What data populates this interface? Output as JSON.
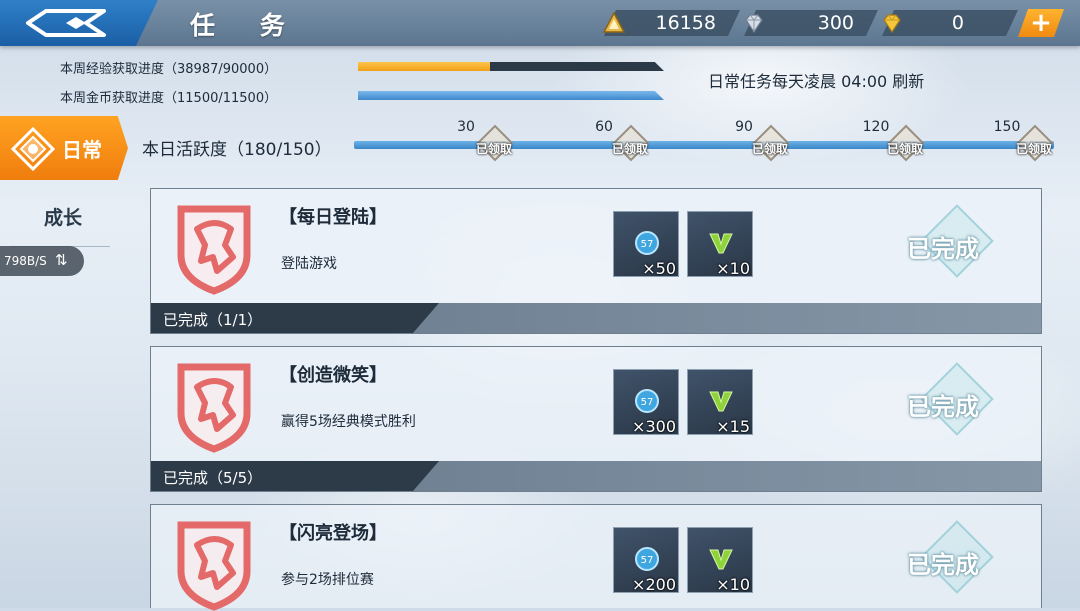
{
  "header": {
    "title": "任 务",
    "currencies": [
      {
        "icon": "gold-triangle-icon",
        "value": "16158"
      },
      {
        "icon": "diamond-icon",
        "value": "300"
      },
      {
        "icon": "gold-diamond-icon",
        "value": "0"
      }
    ],
    "plus_label": "+"
  },
  "weekly": {
    "exp_label": "本周经验获取进度（38987/90000）",
    "exp_progress": 0.433,
    "gold_label": "本周金币获取进度（11500/11500）",
    "gold_progress": 1.0,
    "reset_note": "日常任务每天凌晨 04:00 刷新"
  },
  "sidebar": {
    "tabs": [
      {
        "label": "日常",
        "active": true
      },
      {
        "label": "成长",
        "active": false
      }
    ],
    "net_speed": "798B/S",
    "net_arrows": "⇅"
  },
  "activity": {
    "label": "本日活跃度（180/150）",
    "milestones": [
      {
        "value": "30",
        "status": "已领取"
      },
      {
        "value": "60",
        "status": "已领取"
      },
      {
        "value": "90",
        "status": "已领取"
      },
      {
        "value": "120",
        "status": "已领取"
      },
      {
        "value": "150",
        "status": "已领取"
      }
    ]
  },
  "tasks": [
    {
      "title": "【每日登陆】",
      "desc": "登陆游戏",
      "rewards": [
        {
          "icon": "exp-coin-icon",
          "qty": "×50"
        },
        {
          "icon": "v-token-icon",
          "qty": "×10"
        }
      ],
      "status": "已完成（1/1）",
      "badge": "已完成"
    },
    {
      "title": "【创造微笑】",
      "desc": "赢得5场经典模式胜利",
      "rewards": [
        {
          "icon": "exp-coin-icon",
          "qty": "×300"
        },
        {
          "icon": "v-token-icon",
          "qty": "×15"
        }
      ],
      "status": "已完成（5/5）",
      "badge": "已完成"
    },
    {
      "title": "【闪亮登场】",
      "desc": "参与2场排位赛",
      "rewards": [
        {
          "icon": "exp-coin-icon",
          "qty": "×200"
        },
        {
          "icon": "v-token-icon",
          "qty": "×10"
        }
      ],
      "badge": "已完成"
    }
  ],
  "colors": {
    "accent_orange": "#f08a10",
    "exp_bar": "#f5a623",
    "gold_bar": "#4a90d9",
    "track_blue": "#3a86c8"
  }
}
